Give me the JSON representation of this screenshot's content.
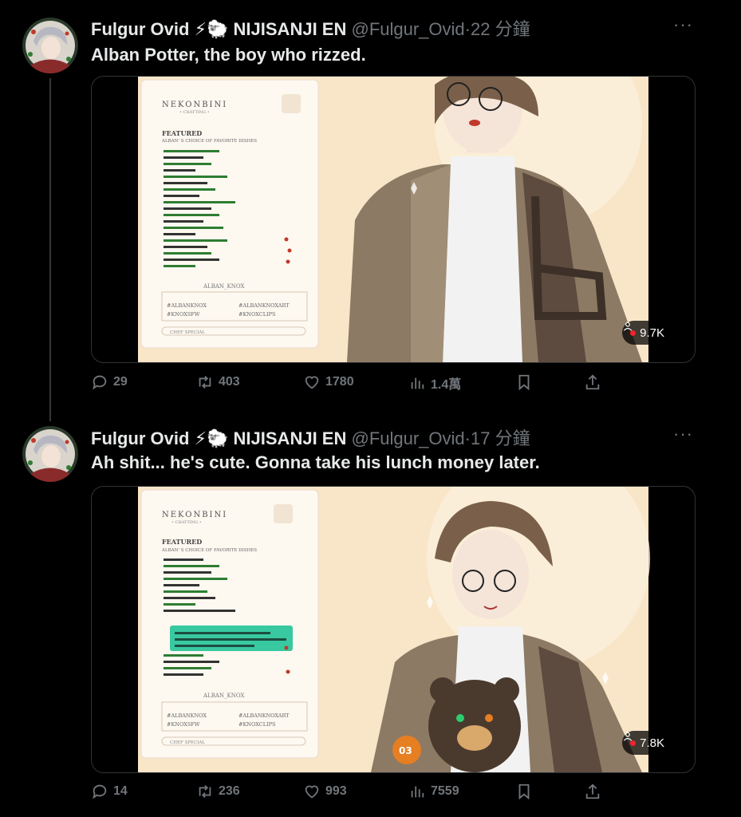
{
  "tweets": [
    {
      "author_name": "Fulgur Ovid",
      "name_suffix": "⚡🐑 NIJISANJI EN",
      "handle": "@Fulgur_Ovid",
      "separator": "·",
      "time": "22 分鐘",
      "more": "···",
      "text": "Alban Potter, the boy who rizzed.",
      "views_badge": "9.7K",
      "stats": {
        "replies": "29",
        "retweets": "403",
        "likes": "1780",
        "views": "1.4萬"
      },
      "overlay": {
        "brand": "NEKONBINI",
        "sub": "• CHATTING •",
        "heading": "FEATURED",
        "subheading": "ALBAN' S CHOICE OF FAVORITE DISHES",
        "social": "ALBAN_KNOX",
        "tags": [
          "#ALBANKNOX",
          "#ALBANKNOXART",
          "#KNOXSFW",
          "#KNOXCLIPS"
        ],
        "footer": "CHEF SPECIAL"
      }
    },
    {
      "author_name": "Fulgur Ovid",
      "name_suffix": "⚡🐑 NIJISANJI EN",
      "handle": "@Fulgur_Ovid",
      "separator": "·",
      "time": "17 分鐘",
      "more": "···",
      "text": "Ah shit... he's cute. Gonna take his lunch money later.",
      "views_badge": "7.8K",
      "stats": {
        "replies": "14",
        "retweets": "236",
        "likes": "993",
        "views": "7559"
      },
      "overlay": {
        "brand": "NEKONBINI",
        "sub": "• CHATTING •",
        "heading": "FEATURED",
        "subheading": "ALBAN' S CHOICE OF FAVORITE DISHES",
        "social": "ALBAN_KNOX",
        "tags": [
          "#ALBANKNOX",
          "#ALBANKNOXART",
          "#KNOXSFW",
          "#KNOXCLIPS"
        ],
        "footer": "CHEF SPECIAL",
        "bear_badge": "03"
      }
    }
  ],
  "colors": {
    "bg": "#000000",
    "text": "#e7e9ea",
    "muted": "#71767b",
    "live_dot": "#f4212e",
    "panel": "#fdf6ea",
    "stream_bg": "#f9e6c8"
  }
}
